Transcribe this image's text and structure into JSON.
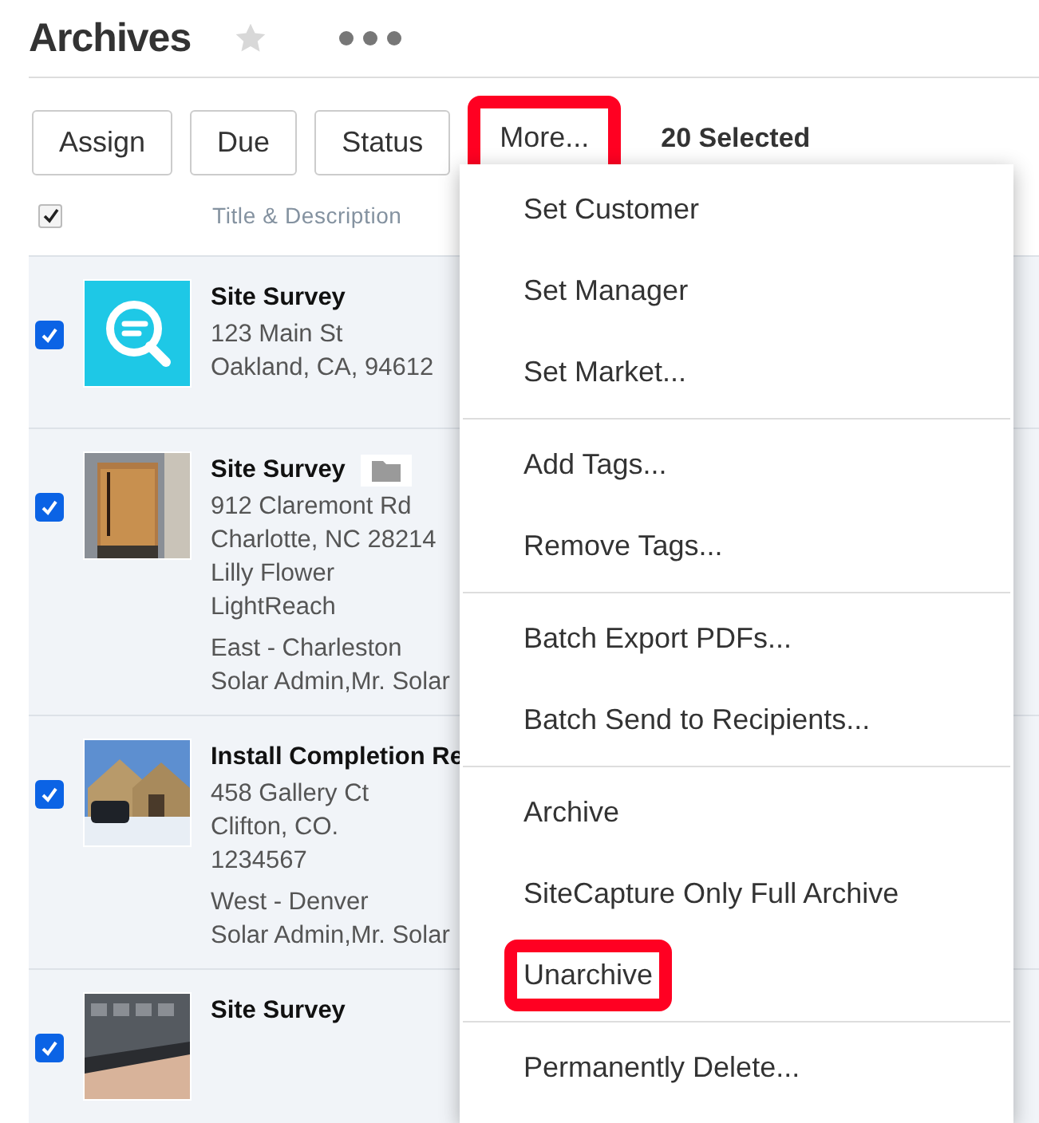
{
  "title": "Archives",
  "favorite": false,
  "toolbar": {
    "buttons": [
      {
        "label": "Assign",
        "highlighted": false
      },
      {
        "label": "Due",
        "highlighted": false
      },
      {
        "label": "Status",
        "highlighted": false
      },
      {
        "label": "More...",
        "highlighted": true
      }
    ],
    "selection_count": "20 Selected"
  },
  "table": {
    "header": {
      "checked": true,
      "column": "Title & Description"
    },
    "rows": [
      {
        "checked": true,
        "thumbnail": {
          "kind": "icon"
        },
        "title": "Site Survey",
        "folder": false,
        "address": [
          "123 Main St",
          "Oakland, CA, 94612"
        ],
        "details": []
      },
      {
        "checked": true,
        "thumbnail": {
          "kind": "picture"
        },
        "title": "Site Survey",
        "folder": true,
        "address": [
          "912 Claremont Rd",
          "Charlotte, NC 28214",
          "Lilly Flower",
          "LightReach"
        ],
        "details": [
          "East - Charleston",
          "Solar Admin,Mr. Solar"
        ]
      },
      {
        "checked": true,
        "thumbnail": {
          "kind": "picture"
        },
        "title": "Install Completion Re",
        "folder": false,
        "address": [
          "458 Gallery Ct",
          "Clifton, CO.",
          "1234567"
        ],
        "details": [
          "West - Denver",
          "Solar Admin,Mr. Solar"
        ]
      },
      {
        "checked": true,
        "thumbnail": {
          "kind": "picture"
        },
        "title": "Site Survey",
        "folder": false,
        "address": [],
        "details": []
      }
    ]
  },
  "menu": {
    "groups": [
      [
        {
          "label": "Set Customer",
          "highlighted": false
        },
        {
          "label": "Set Manager",
          "highlighted": false
        },
        {
          "label": "Set Market...",
          "highlighted": false
        }
      ],
      [
        {
          "label": "Add Tags...",
          "highlighted": false
        },
        {
          "label": "Remove Tags...",
          "highlighted": false
        }
      ],
      [
        {
          "label": "Batch Export PDFs...",
          "highlighted": false
        },
        {
          "label": "Batch Send to Recipients...",
          "highlighted": false
        }
      ],
      [
        {
          "label": "Archive",
          "highlighted": false
        },
        {
          "label": "SiteCapture Only Full Archive",
          "highlighted": false
        },
        {
          "label": "Unarchive",
          "highlighted": true
        }
      ],
      [
        {
          "label": "Permanently Delete...",
          "highlighted": false
        }
      ]
    ]
  }
}
